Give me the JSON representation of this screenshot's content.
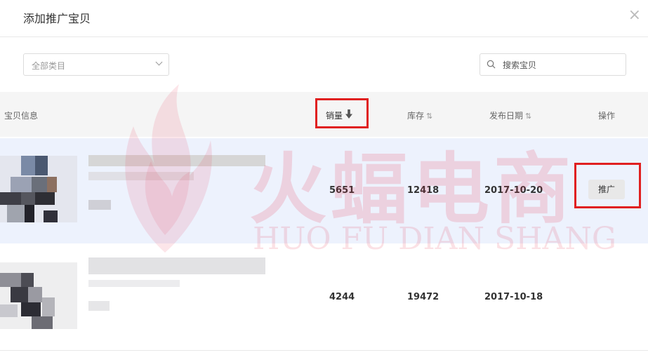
{
  "dialog": {
    "title": "添加推广宝贝",
    "close_symbol": "×"
  },
  "filters": {
    "category_selected": "全部类目",
    "search_placeholder": "搜索宝贝"
  },
  "table": {
    "headers": {
      "info": "宝贝信息",
      "sales": "销量",
      "stock": "库存",
      "date": "发布日期",
      "operation": "操作"
    },
    "sort_arrow": "⇅",
    "rows": [
      {
        "sales": "5651",
        "stock": "12418",
        "date": "2017-10-20",
        "action_label": "推广"
      },
      {
        "sales": "4244",
        "stock": "19472",
        "date": "2017-10-18",
        "action_label": ""
      }
    ]
  },
  "watermark": {
    "main": "火蝠电商",
    "sub": "HUO FU DIAN SHANG"
  },
  "colors": {
    "highlight": "#e02020",
    "row_selected_bg": "#edf2fd"
  }
}
